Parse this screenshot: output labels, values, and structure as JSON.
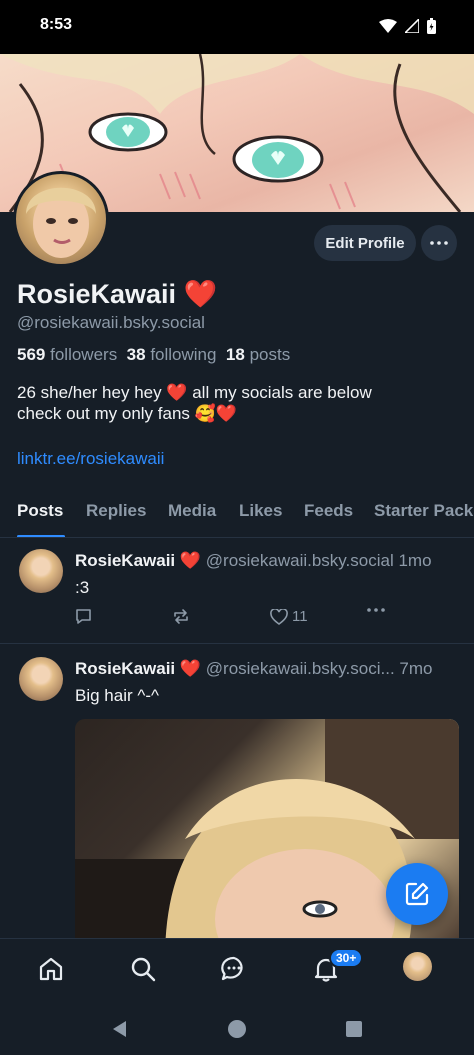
{
  "status": {
    "time": "8:53"
  },
  "profile": {
    "display_name": "RosieKawaii",
    "name_emoji": "❤️",
    "handle": "@rosiekawaii.bsky.social",
    "edit_label": "Edit Profile",
    "followers_count": "569",
    "followers_label": "followers",
    "following_count": "38",
    "following_label": "following",
    "posts_count": "18",
    "posts_label": "posts",
    "bio": "26 she/her hey hey ❤️ all my socials are below\ncheck out my only fans 🥰❤️",
    "link": "linktr.ee/rosiekawaii"
  },
  "tabs": [
    "Posts",
    "Replies",
    "Media",
    "Likes",
    "Feeds",
    "Starter Packs"
  ],
  "posts": [
    {
      "name": "RosieKawaii ❤️",
      "handle": "@rosiekawaii.bsky.social",
      "time": "1mo",
      "text": ":3",
      "like_count": "11"
    },
    {
      "name": "RosieKawaii ❤️",
      "handle": "@rosiekawaii.bsky.soci...",
      "time": "7mo",
      "text": "Big hair ^-^"
    }
  ],
  "nav": {
    "notifications_badge": "30+"
  },
  "colors": {
    "background": "#161e27",
    "accent": "#2f8cff",
    "muted": "#8d9aa8"
  }
}
